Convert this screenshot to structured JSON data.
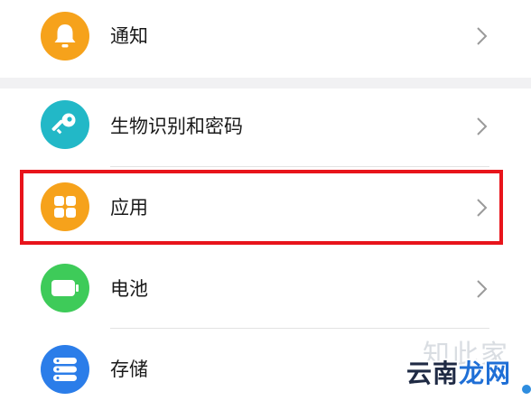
{
  "settings": {
    "items": [
      {
        "label": "通知",
        "icon": "bell-icon",
        "color": "#f6a21b"
      },
      {
        "label": "生物识别和密码",
        "icon": "key-icon",
        "color": "#22b8c7"
      },
      {
        "label": "应用",
        "icon": "apps-grid-icon",
        "color": "#f6a21b"
      },
      {
        "label": "电池",
        "icon": "battery-icon",
        "color": "#3ecb59"
      },
      {
        "label": "存储",
        "icon": "storage-icon",
        "color": "#2b7de9"
      }
    ]
  },
  "highlight_color": "#e8141b",
  "watermark": {
    "line1": "知此家",
    "line2_a": "云南",
    "line2_b": "龙网"
  }
}
